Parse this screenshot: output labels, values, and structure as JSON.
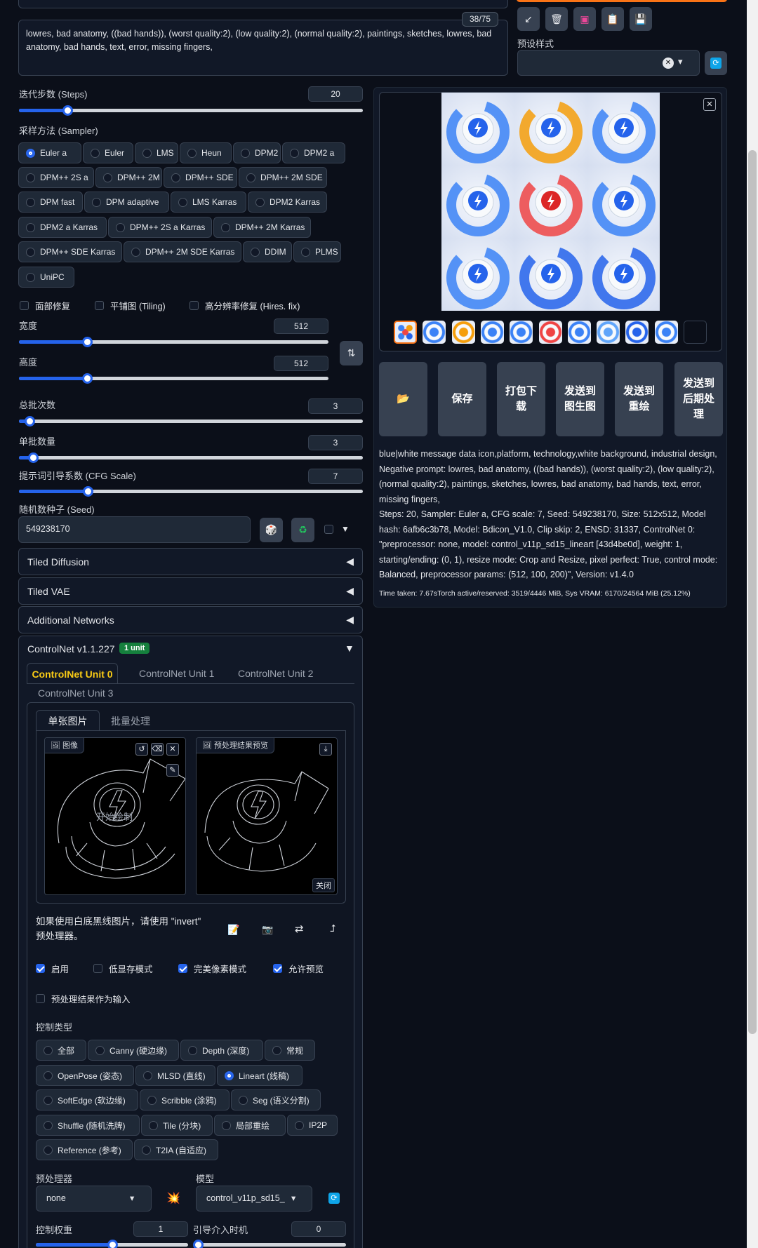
{
  "prompt": {
    "token_counter": "38/75",
    "negative_text": "lowres, bad anatomy, ((bad hands)), (worst quality:2), (low quality:2), (normal quality:2), paintings, sketches, lowres, bad anatomy, bad hands, text, error, missing fingers,"
  },
  "toolbar": {
    "icons": [
      "arrow-icon",
      "trash-icon",
      "card-icon",
      "clipboard-icon",
      "save-icon"
    ],
    "style_label": "预设样式",
    "style_clear": "✕",
    "style_arrow": "▾"
  },
  "params": {
    "steps_label": "迭代步数 (Steps)",
    "steps_value": "20",
    "steps_frac": 0.14,
    "sampler_label": "采样方法 (Sampler)",
    "samplers": [
      "Euler a",
      "Euler",
      "LMS",
      "Heun",
      "DPM2",
      "DPM2 a",
      "DPM++ 2S a",
      "DPM++ 2M",
      "DPM++ SDE",
      "DPM++ 2M SDE",
      "DPM fast",
      "DPM adaptive",
      "LMS Karras",
      "DPM2 Karras",
      "DPM2 a Karras",
      "DPM++ 2S a Karras",
      "DPM++ 2M Karras",
      "DPM++ SDE Karras",
      "DPM++ 2M SDE Karras",
      "DDIM",
      "PLMS",
      "UniPC"
    ],
    "sampler_selected": "Euler a",
    "restore_faces": "面部修复",
    "tiling": "平铺图 (Tiling)",
    "hires_fix": "高分辨率修复 (Hires. fix)",
    "width_label": "宽度",
    "width_value": "512",
    "width_frac": 0.22,
    "height_label": "高度",
    "height_value": "512",
    "height_frac": 0.22,
    "batch_count_label": "总批次数",
    "batch_count_value": "3",
    "batch_count_frac": 0.03,
    "batch_size_label": "单批数量",
    "batch_size_value": "3",
    "batch_size_frac": 0.04,
    "cfg_label": "提示词引导系数 (CFG Scale)",
    "cfg_value": "7",
    "cfg_frac": 0.2,
    "seed_label": "随机数种子 (Seed)",
    "seed_value": "549238170",
    "swap_icon": "⇅",
    "dice_icon": "🎲",
    "recycle_icon": "♻",
    "extra_arrow": "▼"
  },
  "accordions": [
    {
      "label": "Tiled Diffusion",
      "arrow": "◀"
    },
    {
      "label": "Tiled VAE",
      "arrow": "◀"
    },
    {
      "label": "Additional Networks",
      "arrow": "◀"
    }
  ],
  "controlnet": {
    "title": "ControlNet v1.1.227",
    "badge": "1 unit",
    "arrow": "▼",
    "unit_tabs": [
      "ControlNet Unit 0",
      "ControlNet Unit 1",
      "ControlNet Unit 2",
      "ControlNet Unit 3"
    ],
    "sub_tabs": [
      "单张图片",
      "批量处理"
    ],
    "image_label": "图像",
    "preview_label": "预处理结果预览",
    "start_draw": "开始绘制",
    "close_label": "关闭",
    "hint": "如果使用白底黑线图片，请使用 \"invert\" 预处理器。",
    "enable": "启用",
    "lowvram": "低显存模式",
    "pixel_perfect": "完美像素模式",
    "allow_preview": "允许预览",
    "preproc_as_input": "预处理结果作为输入",
    "control_type_label": "控制类型",
    "control_types": [
      "全部",
      "Canny (硬边缘)",
      "Depth (深度)",
      "常规",
      "OpenPose (姿态)",
      "MLSD (直线)",
      "Lineart (线稿)",
      "SoftEdge (软边缘)",
      "Scribble (涂鸦)",
      "Seg (语义分割)",
      "Shuffle (随机洗牌)",
      "Tile (分块)",
      "局部重绘",
      "IP2P",
      "Reference (参考)",
      "T2IA (自适应)"
    ],
    "control_type_selected": "Lineart (线稿)",
    "preprocessor_label": "预处理器",
    "preprocessor_value": "none",
    "model_label": "模型",
    "model_value": "control_v11p_sd15_",
    "weight_label": "控制权重",
    "weight_value": "1",
    "weight_frac": 0.5,
    "start_label": "引导介入时机",
    "start_value": "0",
    "start_frac": 0.0
  },
  "output": {
    "close_icon": "✕",
    "actions": [
      "📂",
      "保存",
      "打包下载",
      "发送到图生图",
      "发送到重绘",
      "发送到后期处理"
    ],
    "info_prompt": "blue|white message data icon,platform, technology,white background, industrial design,",
    "info_negative": "Negative prompt: lowres, bad anatomy, ((bad hands)), (worst quality:2), (low quality:2), (normal quality:2), paintings, sketches, lowres, bad anatomy, bad hands, text, error, missing fingers,",
    "info_params": "Steps: 20, Sampler: Euler a, CFG scale: 7, Seed: 549238170, Size: 512x512, Model hash: 6afb6c3b78, Model: Bdicon_V1.0, Clip skip: 2, ENSD: 31337, ControlNet 0: \"preprocessor: none, model: control_v11p_sd15_lineart [43d4be0d], weight: 1, starting/ending: (0, 1), resize mode: Crop and Resize, pixel perfect: True, control mode: Balanced, preprocessor params: (512, 100, 200)\", Version: v1.4.0",
    "time_taken": "Time taken: 7.67sTorch active/reserved: 3519/4446 MiB, Sys VRAM: 6170/24564 MiB (25.12%)"
  },
  "colors": {
    "accent": "#2563eb",
    "bg": "#0b0f19",
    "panel": "#111827",
    "green": "#16a34a",
    "orange": "#f97316"
  }
}
